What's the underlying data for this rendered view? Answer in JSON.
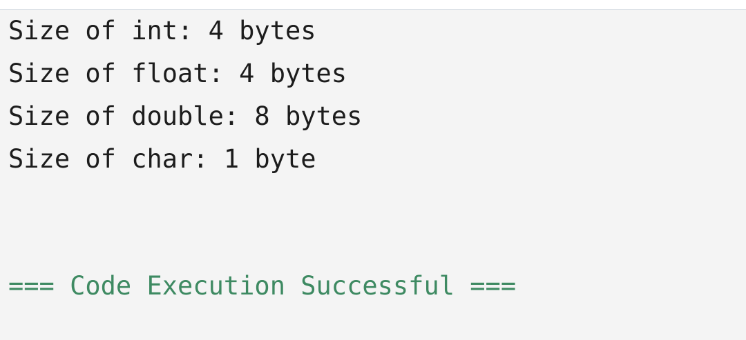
{
  "console": {
    "lines": [
      "Size of int: 4 bytes",
      "Size of float: 4 bytes",
      "Size of double: 8 bytes",
      "Size of char: 1 byte"
    ],
    "status": "=== Code Execution Successful ==="
  },
  "colors": {
    "background": "#f4f4f4",
    "text": "#1c1c1c",
    "success": "#3e8a62"
  }
}
